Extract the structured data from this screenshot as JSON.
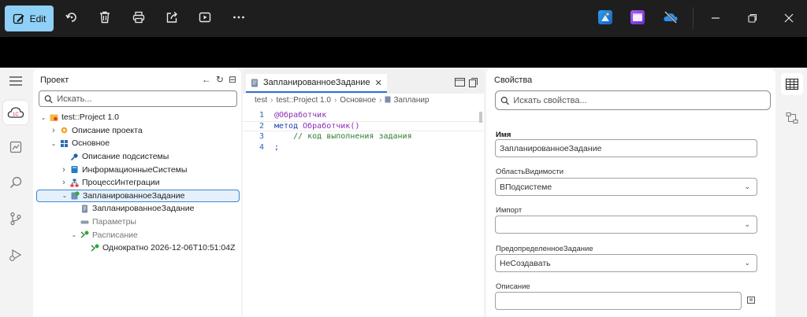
{
  "toolbar": {
    "edit_label": "Edit"
  },
  "project": {
    "title": "Проект",
    "search_placeholder": "Искать...",
    "tree": [
      {
        "label": "test::Project 1.0",
        "indent": 0,
        "chev": "down",
        "icon": "project-icon"
      },
      {
        "label": "Описание проекта",
        "indent": 1,
        "chev": "right",
        "icon": "gear-icon"
      },
      {
        "label": "Основное",
        "indent": 1,
        "chev": "down",
        "icon": "grid-icon"
      },
      {
        "label": "Описание подсистемы",
        "indent": 2,
        "chev": "none",
        "icon": "key-icon"
      },
      {
        "label": "ИнформационныеСистемы",
        "indent": 2,
        "chev": "right",
        "icon": "book-icon"
      },
      {
        "label": "ПроцессИнтеграции",
        "indent": 2,
        "chev": "right",
        "icon": "process-icon"
      },
      {
        "label": "ЗапланированноеЗадание",
        "indent": 2,
        "chev": "down",
        "icon": "task-icon",
        "selected": true
      },
      {
        "label": "ЗапланированноеЗадание",
        "indent": 3,
        "chev": "none",
        "icon": "module-icon"
      },
      {
        "label": "Параметры",
        "indent": 3,
        "chev": "none",
        "icon": "params-icon",
        "muted": true
      },
      {
        "label": "Расписание",
        "indent": 3,
        "chev": "down",
        "icon": "schedule-icon",
        "muted": true
      },
      {
        "label": "Однократно 2026-12-06T10:51:04Z",
        "indent": 4,
        "chev": "none",
        "icon": "schedule-item-icon"
      }
    ]
  },
  "editor": {
    "tab_label": "ЗапланированноеЗадание",
    "breadcrumbs": [
      "test",
      "test::Project 1.0",
      "Основное",
      "Запланир"
    ],
    "code": [
      {
        "num": "1",
        "parts": [
          {
            "t": "@Обработчик",
            "c": "kw-purple"
          }
        ]
      },
      {
        "num": "2",
        "parts": [
          {
            "t": "метод ",
            "c": "kw-blue"
          },
          {
            "t": "Обработчик()",
            "c": "kw-purple"
          }
        ]
      },
      {
        "num": "3",
        "parts": [
          {
            "t": "    // код выполнения задания",
            "c": "kw-green"
          }
        ]
      },
      {
        "num": "4",
        "parts": [
          {
            "t": ";",
            "c": "kw-blue"
          }
        ]
      }
    ]
  },
  "properties": {
    "title": "Свойства",
    "search_placeholder": "Искать свойства...",
    "name_label": "Имя",
    "name_value": "ЗапланированноеЗадание",
    "scope_label": "ОбластьВидимости",
    "scope_value": "ВПодсистеме",
    "import_label": "Импорт",
    "import_value": "",
    "predefined_label": "ПредопределенноеЗадание",
    "predefined_value": "НеСоздавать",
    "description_label": "Описание"
  }
}
